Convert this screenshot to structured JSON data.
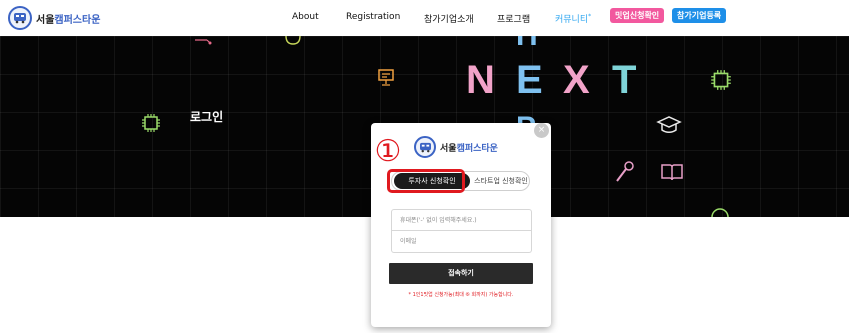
{
  "header": {
    "logo": {
      "icon": "bus-icon",
      "text_prefix": "서울",
      "text_accent": "캠퍼스타운"
    },
    "nav": [
      {
        "label": "About"
      },
      {
        "label": "Registration"
      },
      {
        "label": "참가기업소개"
      },
      {
        "label": "프로그램"
      },
      {
        "label": "커뮤니티",
        "badge": "*"
      }
    ],
    "buttons": [
      {
        "label": "밋업신청확인"
      },
      {
        "label": "참가기업등록"
      }
    ]
  },
  "hero": {
    "title": "로그인",
    "banner_letters": [
      "N",
      "E",
      "X",
      "T"
    ],
    "colors": {
      "n": "#f2a3c9",
      "e": "#7fc1f0",
      "x": "#f2a3c9",
      "t": "#7fd4d8"
    }
  },
  "modal": {
    "logo": {
      "text_prefix": "서울",
      "text_accent": "캠퍼스타운"
    },
    "close_label": "×",
    "tabs": [
      {
        "label": "투자사 신청확인",
        "active": true
      },
      {
        "label": "스타트업 신청확인",
        "active": false
      }
    ],
    "phone_placeholder": "휴대폰('-' 없이 입력해주세요.)",
    "email_placeholder": "이메일",
    "submit_label": "접속하기",
    "notice": "* 1인1밋업 신청가능(최대 ⑥ 회까지) 가능합니다."
  },
  "annotation": {
    "number": "①",
    "color": "#e0191f"
  }
}
